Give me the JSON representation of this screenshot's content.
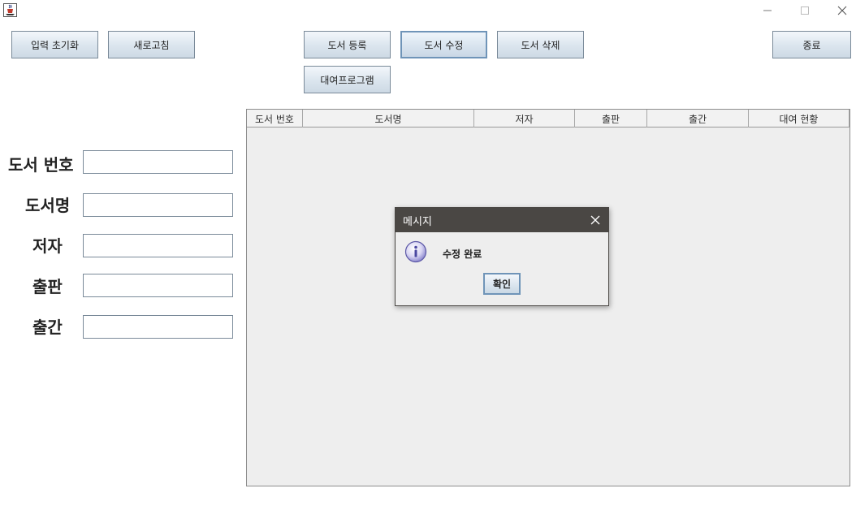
{
  "window": {
    "app_icon": "java-cup-icon",
    "controls": {
      "minimize": "minimize-icon",
      "maximize": "maximize-icon",
      "close": "close-icon"
    }
  },
  "toolbar": {
    "reset_input": "입력 초기화",
    "refresh": "새로고침",
    "register_book": "도서 등록",
    "edit_book": "도서 수정",
    "delete_book": "도서 삭제",
    "exit": "종료",
    "rental_program": "대여프로그램"
  },
  "form": {
    "book_number_label": "도서 번호",
    "book_number_value": "",
    "title_label": "도서명",
    "title_value": "",
    "author_label": "저자",
    "author_value": "",
    "publisher_label": "출판",
    "publisher_value": "",
    "pubdate_label": "출간",
    "pubdate_value": ""
  },
  "table": {
    "columns": [
      "도서 번호",
      "도서명",
      "저자",
      "출판",
      "출간",
      "대여 현황"
    ],
    "rows": []
  },
  "dialog": {
    "title": "메시지",
    "icon": "info-icon",
    "message": "수정 완료",
    "ok_label": "확인"
  },
  "colors": {
    "dialog_title_bg": "#4a4744",
    "panel_bg": "#eeeeee",
    "button_border": "#7a8a99",
    "focus_border": "#6f94b8"
  }
}
